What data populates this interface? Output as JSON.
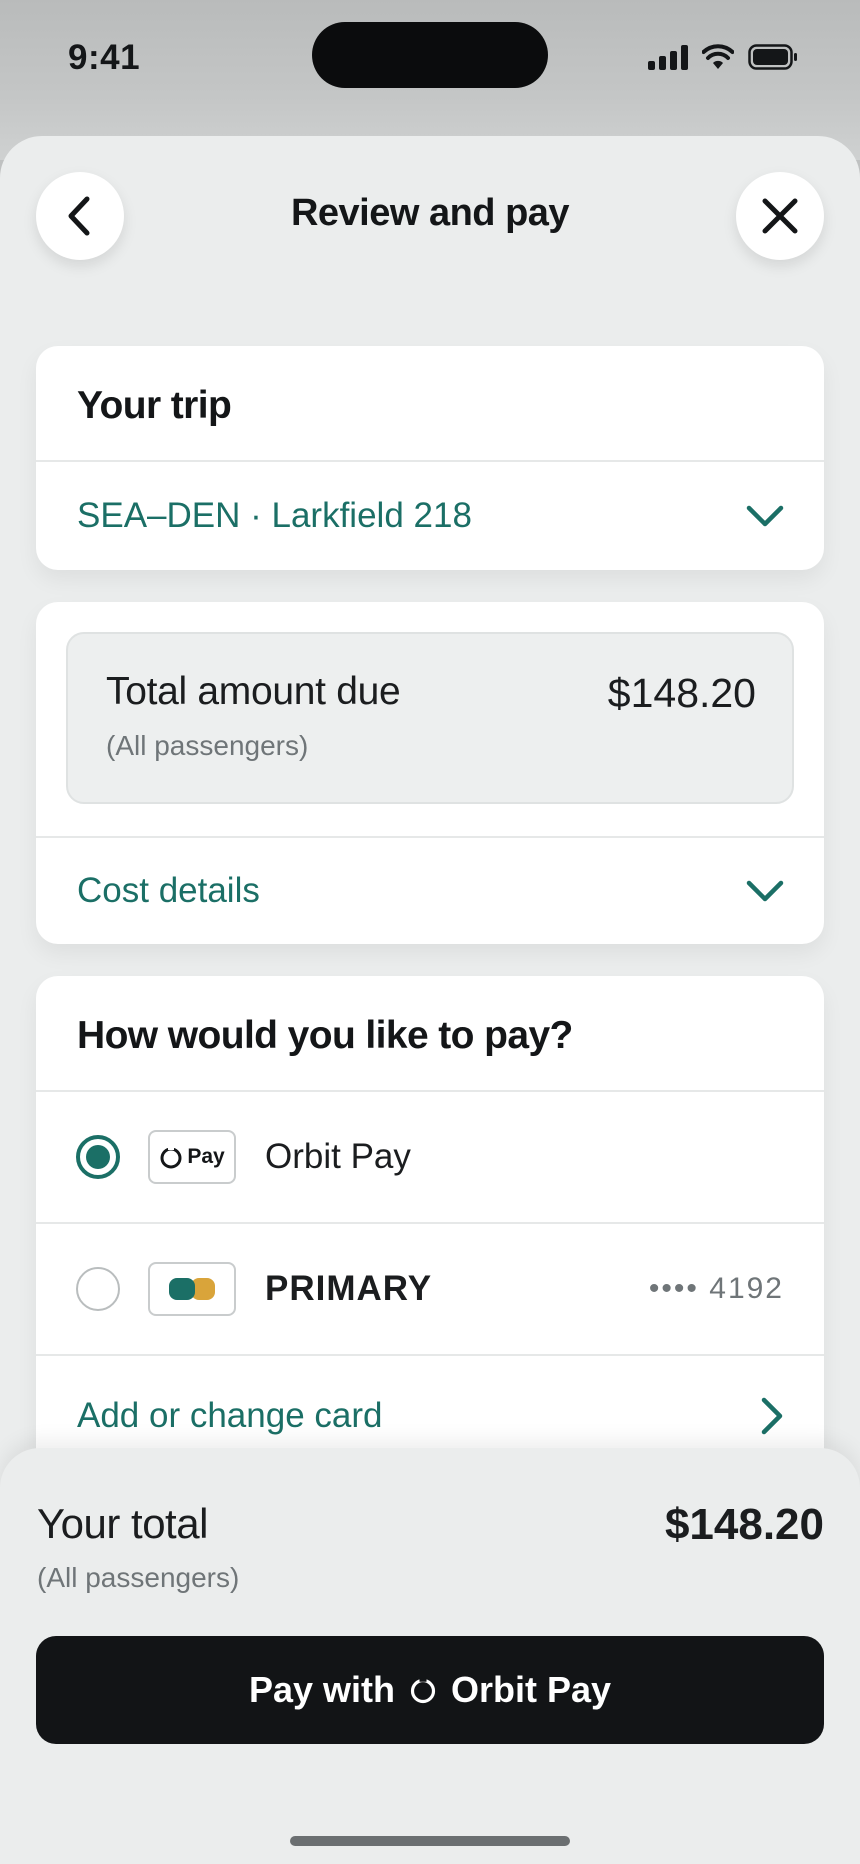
{
  "status_bar": {
    "time": "9:41",
    "icons": [
      "signal-icon",
      "wifi-icon",
      "battery-icon"
    ]
  },
  "header": {
    "title": "Review and pay",
    "back_icon": "chevron-left-icon",
    "close_icon": "close-icon"
  },
  "trip": {
    "title": "Your trip",
    "route": "SEA–DEN · Larkfield 218",
    "expand_icon": "chevron-down-icon"
  },
  "amount": {
    "label": "Total amount due",
    "sublabel": "(All passengers)",
    "value": "$148.20",
    "details_link": "Cost details"
  },
  "payment": {
    "title": "How would you like to pay?",
    "options": [
      {
        "name": "Orbit Pay",
        "logo_text": "Pay",
        "selected": true,
        "icon": "orbit-pay-logo-icon"
      },
      {
        "name": "PRIMARY",
        "masked_number": "•••• 4192",
        "selected": false,
        "icon": "card-logo-icon"
      }
    ],
    "add_card_link": "Add or change card"
  },
  "footer": {
    "total_label": "Your total",
    "total_sublabel": "(All passengers)",
    "total_value": "$148.20",
    "pay_button_prefix": "Pay with",
    "pay_button_brand": "Orbit Pay"
  },
  "colors": {
    "accent": "#1b6f66",
    "button_bg": "#121416",
    "sheet_bg": "#ebeded"
  }
}
